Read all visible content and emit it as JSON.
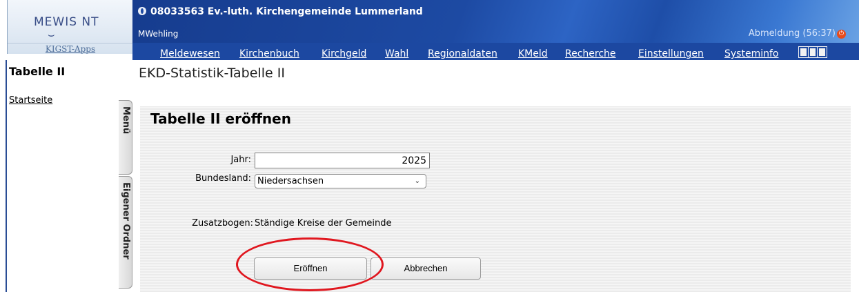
{
  "header": {
    "logo_text": "MEWIS NT",
    "logo_sub": "KIGST-Apps",
    "parish": "08033563 Ev.-luth. Kirchengemeinde Lummerland",
    "user": "MWehling",
    "logout": "Abmeldung (56:37)"
  },
  "nav": {
    "items": [
      "Meldewesen",
      "Kirchenbuch",
      "Kirchgeld",
      "Wahl",
      "Regionaldaten",
      "KMeld",
      "Recherche",
      "Einstellungen",
      "Systeminfo"
    ]
  },
  "sidebar": {
    "title": "Tabelle II",
    "start_link": "Startseite",
    "tab_menu": "Menü",
    "tab_folder": "Eigener Ordner"
  },
  "main": {
    "page_title": "EKD-Statistik-Tabelle II",
    "panel_title": "Tabelle II eröffnen",
    "year_label": "Jahr:",
    "year_value": "2025",
    "state_label": "Bundesland:",
    "state_value": "Niedersachsen",
    "extra_label": "Zusatzbogen:",
    "extra_value": "Ständige Kreise der Gemeinde",
    "open_button": "Eröffnen",
    "cancel_button": "Abbrechen"
  },
  "colors": {
    "header_blue": "#1c48a1",
    "highlight": "#e0171f"
  }
}
